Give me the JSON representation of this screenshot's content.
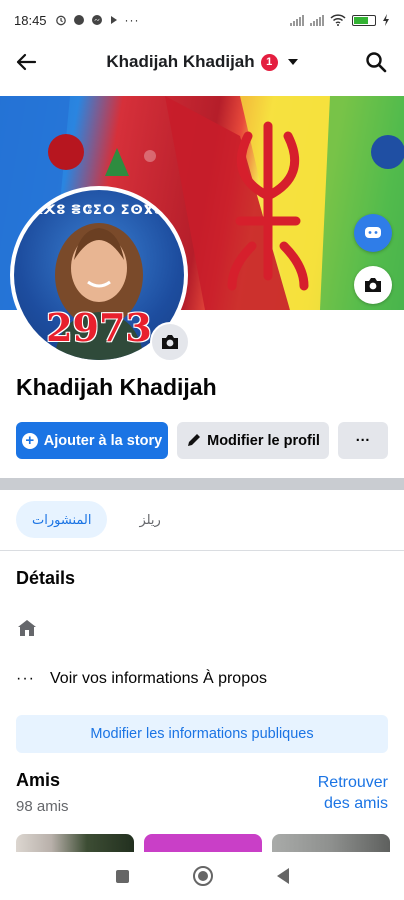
{
  "status_bar": {
    "time": "18:45",
    "battery_level": 0.62
  },
  "header": {
    "title": "Khadijah Khadijah",
    "notification_count": "1"
  },
  "cover": {
    "avatar_banner_text": "ⵓⵅⵅⵓ ⴻⵛⵉⵔ ⵉⵙⴳⴰⵙ",
    "avatar_number": "2973"
  },
  "profile": {
    "name": "Khadijah Khadijah"
  },
  "actions": {
    "add_story_label": "Ajouter à la story",
    "edit_profile_label": "Modifier le profil",
    "more_label": "···"
  },
  "tabs": [
    {
      "label": "المنشورات",
      "active": true
    },
    {
      "label": "ريلز",
      "active": false
    }
  ],
  "details": {
    "title": "Détails",
    "about_link": "Voir vos informations À propos",
    "about_dots": "···",
    "edit_public_label": "Modifier les informations publiques"
  },
  "friends": {
    "title": "Amis",
    "count_label": "98 amis",
    "find_friends_label": "Retrouver des amis"
  },
  "colors": {
    "accent": "#1b74e4",
    "badge": "#e41e3f"
  }
}
